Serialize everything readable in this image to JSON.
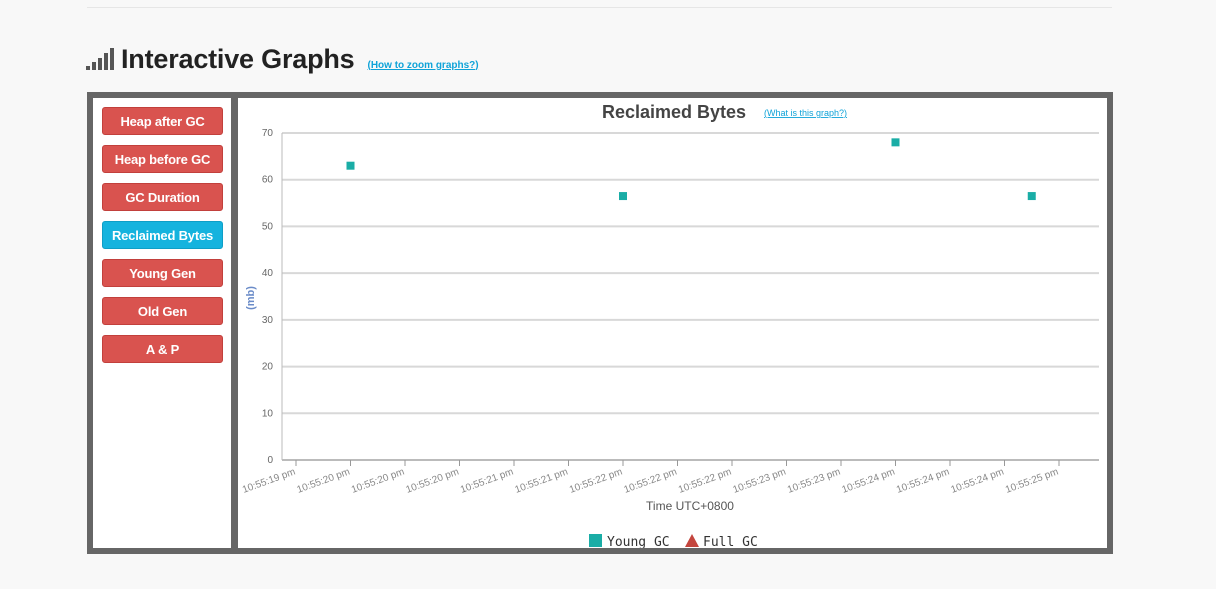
{
  "header": {
    "title": "Interactive Graphs",
    "zoom_link": "(How to zoom graphs?)"
  },
  "sidebar": {
    "buttons": [
      {
        "label": "Heap after GC",
        "active": false
      },
      {
        "label": "Heap before GC",
        "active": false
      },
      {
        "label": "GC Duration",
        "active": false
      },
      {
        "label": "Reclaimed Bytes",
        "active": true
      },
      {
        "label": "Young Gen",
        "active": false
      },
      {
        "label": "Old Gen",
        "active": false
      },
      {
        "label": "A & P",
        "active": false
      }
    ]
  },
  "colors": {
    "button": "#d9534f",
    "button_active": "#15b3de",
    "young_gc": "#1aada6",
    "full_gc": "#c4463e"
  },
  "chart_data": {
    "type": "scatter",
    "title": "Reclaimed Bytes",
    "help_link": "(What is this graph?)",
    "xlabel": "Time UTC+0800",
    "ylabel": "(mb)",
    "ylim": [
      0,
      70
    ],
    "yticks": [
      0,
      10,
      20,
      30,
      40,
      50,
      60,
      70
    ],
    "xticks": [
      "10:55:19 pm",
      "10:55:20 pm",
      "10:55:20 pm",
      "10:55:20 pm",
      "10:55:21 pm",
      "10:55:21 pm",
      "10:55:22 pm",
      "10:55:22 pm",
      "10:55:22 pm",
      "10:55:23 pm",
      "10:55:23 pm",
      "10:55:24 pm",
      "10:55:24 pm",
      "10:55:24 pm",
      "10:55:25 pm"
    ],
    "grid": true,
    "legend": "bottom-center",
    "series": [
      {
        "name": "Young GC",
        "marker": "square",
        "x": [
          "10:55:20 pm",
          "10:55:22 pm",
          "10:55:24 pm",
          "10:55:24 pm"
        ],
        "x_index": [
          1.0,
          6.0,
          11.0,
          13.5
        ],
        "values": [
          63,
          56.5,
          68,
          56.5
        ]
      },
      {
        "name": "Full GC",
        "marker": "triangle",
        "x": [],
        "x_index": [],
        "values": []
      }
    ]
  }
}
